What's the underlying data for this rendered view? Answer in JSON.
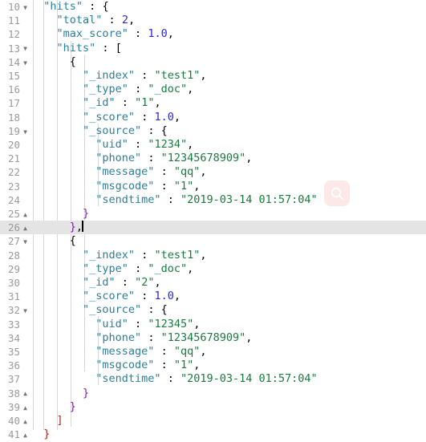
{
  "editor": {
    "language": "json",
    "active_line": 26,
    "first_line": 10,
    "last_line": 41,
    "cursor": {
      "line": 26,
      "column": 11
    },
    "colors": {
      "background": "#ffffff",
      "active_line": "#e4e4e4",
      "gutter_text": "#9a9a9a",
      "key": "#2a7f9e",
      "string": "#1a7a3e",
      "number": "#2929cc",
      "punctuation": "#000000",
      "indent_guide": "#d7d7d7",
      "search_button_bg": "#fde8e8",
      "search_button_icon": "#ffffff"
    }
  },
  "search_button": {
    "icon": "search-icon",
    "label": "Search"
  },
  "lines": [
    {
      "n": "10",
      "fold": "down",
      "indent": 1,
      "tokens": [
        {
          "t": "k",
          "v": "\"hits\""
        },
        {
          "t": "p",
          "v": " : "
        },
        {
          "t": "br",
          "v": "{"
        }
      ]
    },
    {
      "n": "11",
      "fold": "none",
      "indent": 2,
      "tokens": [
        {
          "t": "k",
          "v": "\"total\""
        },
        {
          "t": "p",
          "v": " : "
        },
        {
          "t": "n",
          "v": "2"
        },
        {
          "t": "p",
          "v": ","
        }
      ]
    },
    {
      "n": "12",
      "fold": "none",
      "indent": 2,
      "tokens": [
        {
          "t": "k",
          "v": "\"max_score\""
        },
        {
          "t": "p",
          "v": " : "
        },
        {
          "t": "n",
          "v": "1.0"
        },
        {
          "t": "p",
          "v": ","
        }
      ]
    },
    {
      "n": "13",
      "fold": "down",
      "indent": 2,
      "tokens": [
        {
          "t": "k",
          "v": "\"hits\""
        },
        {
          "t": "p",
          "v": " : "
        },
        {
          "t": "br",
          "v": "["
        }
      ]
    },
    {
      "n": "14",
      "fold": "down",
      "indent": 3,
      "tokens": [
        {
          "t": "br",
          "v": "{"
        }
      ]
    },
    {
      "n": "15",
      "fold": "none",
      "indent": 4,
      "tokens": [
        {
          "t": "k",
          "v": "\"_index\""
        },
        {
          "t": "p",
          "v": " : "
        },
        {
          "t": "s",
          "v": "\"test1\""
        },
        {
          "t": "p",
          "v": ","
        }
      ]
    },
    {
      "n": "16",
      "fold": "none",
      "indent": 4,
      "tokens": [
        {
          "t": "k",
          "v": "\"_type\""
        },
        {
          "t": "p",
          "v": " : "
        },
        {
          "t": "s",
          "v": "\"_doc\""
        },
        {
          "t": "p",
          "v": ","
        }
      ]
    },
    {
      "n": "17",
      "fold": "none",
      "indent": 4,
      "tokens": [
        {
          "t": "k",
          "v": "\"_id\""
        },
        {
          "t": "p",
          "v": " : "
        },
        {
          "t": "s",
          "v": "\"1\""
        },
        {
          "t": "p",
          "v": ","
        }
      ]
    },
    {
      "n": "18",
      "fold": "none",
      "indent": 4,
      "tokens": [
        {
          "t": "k",
          "v": "\"_score\""
        },
        {
          "t": "p",
          "v": " : "
        },
        {
          "t": "n",
          "v": "1.0"
        },
        {
          "t": "p",
          "v": ","
        }
      ]
    },
    {
      "n": "19",
      "fold": "down",
      "indent": 4,
      "tokens": [
        {
          "t": "k",
          "v": "\"_source\""
        },
        {
          "t": "p",
          "v": " : "
        },
        {
          "t": "br",
          "v": "{"
        }
      ]
    },
    {
      "n": "20",
      "fold": "none",
      "indent": 5,
      "tokens": [
        {
          "t": "k",
          "v": "\"uid\""
        },
        {
          "t": "p",
          "v": " : "
        },
        {
          "t": "s",
          "v": "\"1234\""
        },
        {
          "t": "p",
          "v": ","
        }
      ]
    },
    {
      "n": "21",
      "fold": "none",
      "indent": 5,
      "tokens": [
        {
          "t": "k",
          "v": "\"phone\""
        },
        {
          "t": "p",
          "v": " : "
        },
        {
          "t": "s",
          "v": "\"12345678909\""
        },
        {
          "t": "p",
          "v": ","
        }
      ]
    },
    {
      "n": "22",
      "fold": "none",
      "indent": 5,
      "tokens": [
        {
          "t": "k",
          "v": "\"message\""
        },
        {
          "t": "p",
          "v": " : "
        },
        {
          "t": "s",
          "v": "\"qq\""
        },
        {
          "t": "p",
          "v": ","
        }
      ]
    },
    {
      "n": "23",
      "fold": "none",
      "indent": 5,
      "tokens": [
        {
          "t": "k",
          "v": "\"msgcode\""
        },
        {
          "t": "p",
          "v": " : "
        },
        {
          "t": "s",
          "v": "\"1\""
        },
        {
          "t": "p",
          "v": ","
        }
      ]
    },
    {
      "n": "24",
      "fold": "none",
      "indent": 5,
      "tokens": [
        {
          "t": "k",
          "v": "\"sendtime\""
        },
        {
          "t": "p",
          "v": " : "
        },
        {
          "t": "s",
          "v": "\"2019-03-14 01:57:04\""
        }
      ]
    },
    {
      "n": "25",
      "fold": "up",
      "indent": 4,
      "tokens": [
        {
          "t": "br1",
          "v": "}"
        }
      ]
    },
    {
      "n": "26",
      "fold": "up",
      "indent": 3,
      "active": true,
      "caret": true,
      "tokens": [
        {
          "t": "br1",
          "v": "}"
        },
        {
          "t": "p",
          "v": ","
        }
      ]
    },
    {
      "n": "27",
      "fold": "down",
      "indent": 3,
      "tokens": [
        {
          "t": "br",
          "v": "{"
        }
      ]
    },
    {
      "n": "28",
      "fold": "none",
      "indent": 4,
      "tokens": [
        {
          "t": "k",
          "v": "\"_index\""
        },
        {
          "t": "p",
          "v": " : "
        },
        {
          "t": "s",
          "v": "\"test1\""
        },
        {
          "t": "p",
          "v": ","
        }
      ]
    },
    {
      "n": "29",
      "fold": "none",
      "indent": 4,
      "tokens": [
        {
          "t": "k",
          "v": "\"_type\""
        },
        {
          "t": "p",
          "v": " : "
        },
        {
          "t": "s",
          "v": "\"_doc\""
        },
        {
          "t": "p",
          "v": ","
        }
      ]
    },
    {
      "n": "30",
      "fold": "none",
      "indent": 4,
      "tokens": [
        {
          "t": "k",
          "v": "\"_id\""
        },
        {
          "t": "p",
          "v": " : "
        },
        {
          "t": "s",
          "v": "\"2\""
        },
        {
          "t": "p",
          "v": ","
        }
      ]
    },
    {
      "n": "31",
      "fold": "none",
      "indent": 4,
      "tokens": [
        {
          "t": "k",
          "v": "\"_score\""
        },
        {
          "t": "p",
          "v": " : "
        },
        {
          "t": "n",
          "v": "1.0"
        },
        {
          "t": "p",
          "v": ","
        }
      ]
    },
    {
      "n": "32",
      "fold": "down",
      "indent": 4,
      "tokens": [
        {
          "t": "k",
          "v": "\"_source\""
        },
        {
          "t": "p",
          "v": " : "
        },
        {
          "t": "br",
          "v": "{"
        }
      ]
    },
    {
      "n": "33",
      "fold": "none",
      "indent": 5,
      "tokens": [
        {
          "t": "k",
          "v": "\"uid\""
        },
        {
          "t": "p",
          "v": " : "
        },
        {
          "t": "s",
          "v": "\"12345\""
        },
        {
          "t": "p",
          "v": ","
        }
      ]
    },
    {
      "n": "34",
      "fold": "none",
      "indent": 5,
      "tokens": [
        {
          "t": "k",
          "v": "\"phone\""
        },
        {
          "t": "p",
          "v": " : "
        },
        {
          "t": "s",
          "v": "\"12345678909\""
        },
        {
          "t": "p",
          "v": ","
        }
      ]
    },
    {
      "n": "35",
      "fold": "none",
      "indent": 5,
      "tokens": [
        {
          "t": "k",
          "v": "\"message\""
        },
        {
          "t": "p",
          "v": " : "
        },
        {
          "t": "s",
          "v": "\"qq\""
        },
        {
          "t": "p",
          "v": ","
        }
      ]
    },
    {
      "n": "36",
      "fold": "none",
      "indent": 5,
      "tokens": [
        {
          "t": "k",
          "v": "\"msgcode\""
        },
        {
          "t": "p",
          "v": " : "
        },
        {
          "t": "s",
          "v": "\"1\""
        },
        {
          "t": "p",
          "v": ","
        }
      ]
    },
    {
      "n": "37",
      "fold": "none",
      "indent": 5,
      "tokens": [
        {
          "t": "k",
          "v": "\"sendtime\""
        },
        {
          "t": "p",
          "v": " : "
        },
        {
          "t": "s",
          "v": "\"2019-03-14 01:57:04\""
        }
      ]
    },
    {
      "n": "38",
      "fold": "up",
      "indent": 4,
      "tokens": [
        {
          "t": "br1",
          "v": "}"
        }
      ]
    },
    {
      "n": "39",
      "fold": "up",
      "indent": 3,
      "tokens": [
        {
          "t": "br1",
          "v": "}"
        }
      ]
    },
    {
      "n": "40",
      "fold": "up",
      "indent": 2,
      "tokens": [
        {
          "t": "br2",
          "v": "]"
        }
      ]
    },
    {
      "n": "41",
      "fold": "up",
      "indent": 1,
      "tokens": [
        {
          "t": "br2",
          "v": "}"
        }
      ]
    }
  ],
  "json_content": {
    "hits": {
      "total": 2,
      "max_score": 1.0,
      "hits": [
        {
          "_index": "test1",
          "_type": "_doc",
          "_id": "1",
          "_score": 1.0,
          "_source": {
            "uid": "1234",
            "phone": "12345678909",
            "message": "qq",
            "msgcode": "1",
            "sendtime": "2019-03-14 01:57:04"
          }
        },
        {
          "_index": "test1",
          "_type": "_doc",
          "_id": "2",
          "_score": 1.0,
          "_source": {
            "uid": "12345",
            "phone": "12345678909",
            "message": "qq",
            "msgcode": "1",
            "sendtime": "2019-03-14 01:57:04"
          }
        }
      ]
    }
  }
}
